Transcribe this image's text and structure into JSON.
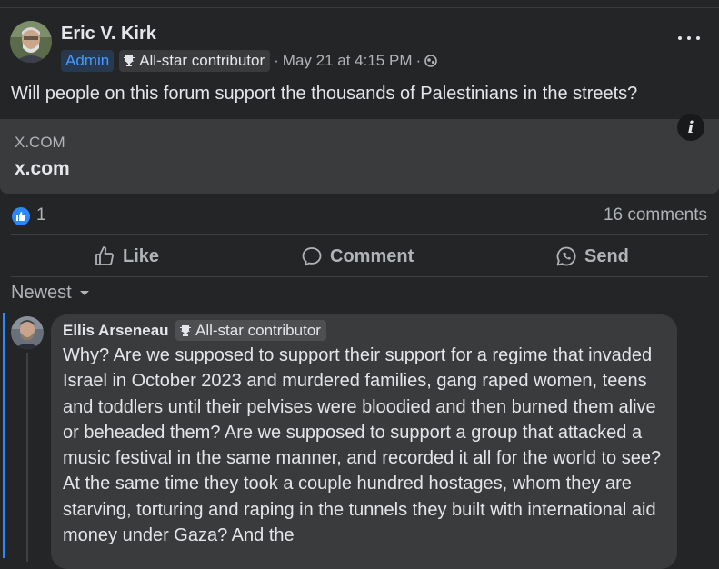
{
  "post": {
    "author": "Eric V. Kirk",
    "admin_badge": "Admin",
    "star_badge": "All-star contributor",
    "timestamp": "May 21 at 4:15 PM",
    "separator": "·",
    "text": "Will people on this forum support the thousands of Palestinians in the streets?",
    "link": {
      "domain": "X.COM",
      "title": "x.com"
    },
    "reactions_count": "1",
    "comments_count": "16 comments"
  },
  "actions": {
    "like": "Like",
    "comment": "Comment",
    "send": "Send"
  },
  "sort": {
    "label": "Newest"
  },
  "comment": {
    "author": "Ellis Arseneau",
    "badge": "All-star contributor",
    "text": "Why? Are we supposed to support their support for a regime that invaded Israel in October 2023 and murdered families, gang raped women, teens and toddlers until their pelvises were bloodied and then burned them alive or beheaded them? Are we supposed to support a group that attacked a music festival in the same manner, and recorded it all for the world to see? At the same time they took a couple hundred hostages, whom they are starving, torturing and raping in the tunnels they built with international aid money under Gaza? And the"
  },
  "colors": {
    "background": "#242526",
    "card": "#3a3b3c",
    "accent": "#2d88ff",
    "admin_text": "#4599ff",
    "muted_text": "#b0b3b8",
    "primary_text": "#e4e6eb"
  }
}
